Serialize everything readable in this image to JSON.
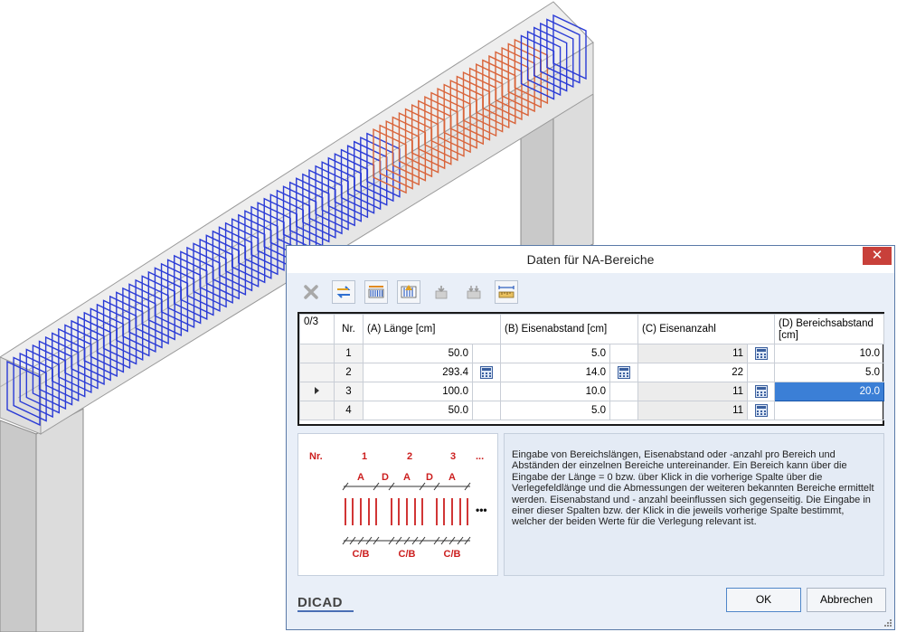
{
  "dialog": {
    "title": "Daten für NA-Bereiche",
    "close_glyph": "✕",
    "toolbar": [
      {
        "name": "delete-icon",
        "enabled": false
      },
      {
        "name": "swap-icon",
        "enabled": true
      },
      {
        "name": "rebar-range-icon",
        "enabled": true
      },
      {
        "name": "rebar-insert-icon",
        "enabled": true
      },
      {
        "name": "rebar-down-icon",
        "enabled": false
      },
      {
        "name": "rebar-down-double-icon",
        "enabled": false
      },
      {
        "name": "measure-icon",
        "enabled": true
      }
    ],
    "grid": {
      "counter": "0/3",
      "headers": {
        "nr": "Nr.",
        "a": "(A) Länge [cm]",
        "b": "(B) Eisenabstand [cm]",
        "c": "(C) Eisenanzahl",
        "d": "(D) Bereichsabstand [cm]"
      },
      "rows": [
        {
          "nr": "1",
          "a": "50.0",
          "b": "5.0",
          "c": "11",
          "d": "10.0"
        },
        {
          "nr": "2",
          "a": "293.4",
          "b": "14.0",
          "c": "22",
          "d": "5.0"
        },
        {
          "nr": "3",
          "a": "100.0",
          "b": "10.0",
          "c": "11",
          "d": "20.0"
        },
        {
          "nr": "4",
          "a": "50.0",
          "b": "5.0",
          "c": "11",
          "d": ""
        }
      ],
      "current_row": 3
    },
    "preview": {
      "nr_label": "Nr.",
      "numbers": [
        "1",
        "2",
        "3"
      ],
      "ellipsis": "...",
      "a_label": "A",
      "d_label": "D",
      "cb_label": "C/B",
      "more": "•••"
    },
    "description": "Eingabe von Bereichslängen, Eisenabstand oder -anzahl pro Bereich und Abständen der einzelnen Bereiche untereinander. Ein Bereich kann über die Eingabe der Länge = 0 bzw. über Klick in die vorherige Spalte über die Verlegefeldlänge und die Abmessungen der weiteren bekannten Bereiche ermittelt werden. Eisenabstand und - anzahl beeinflussen sich gegenseitig. Die Eingabe in einer dieser Spalten bzw. der Klick in die jeweils vorherige Spalte bestimmt, welcher der beiden Werte für die Verlegung relevant ist.",
    "logo": "DICAD",
    "ok_label": "OK",
    "cancel_label": "Abbrechen"
  },
  "colors": {
    "accent": "#3b7fd6",
    "rebar_blue": "#2a3bd6",
    "rebar_orange": "#d9643a",
    "close": "#c8403a",
    "diagram_red": "#cc1f1f"
  }
}
